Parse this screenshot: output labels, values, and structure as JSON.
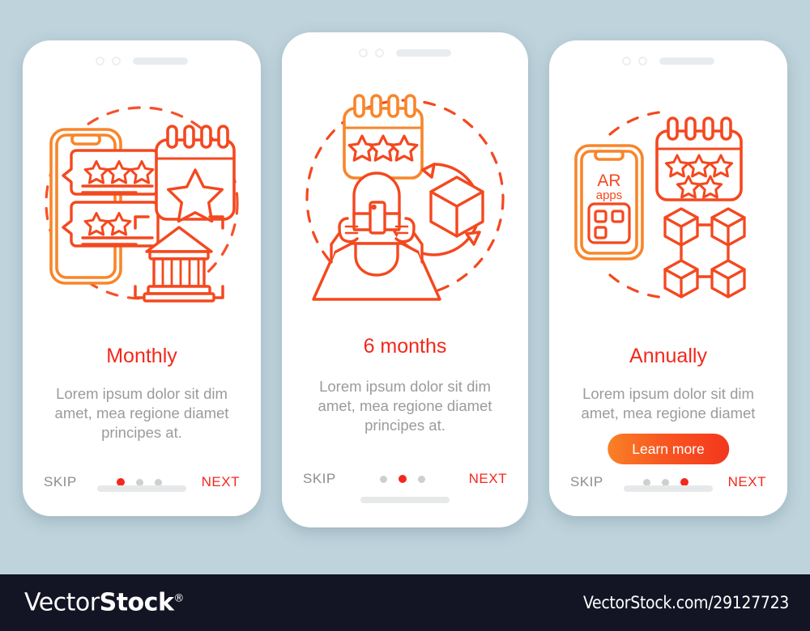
{
  "background_color": "#bed3dc",
  "accent_color": "#f3281c",
  "accent_orange": "#f98126",
  "muted_text_color": "#9b9b9b",
  "screens": [
    {
      "id": "monthly",
      "title": "Monthly",
      "description": "Lorem ipsum dolor sit dim amet, mea regione diamet principes at.",
      "skip_label": "SKIP",
      "next_label": "NEXT",
      "active_dot": 0,
      "dots": 3,
      "cta_label": null,
      "illustration": "phone-reviews-calendar-bank"
    },
    {
      "id": "six-months",
      "title": "6 months",
      "description": "Lorem ipsum dolor sit dim amet, mea regione diamet principes at.",
      "skip_label": "SKIP",
      "next_label": "NEXT",
      "active_dot": 1,
      "dots": 3,
      "cta_label": null,
      "illustration": "vr-person-calendar-cube"
    },
    {
      "id": "annually",
      "title": "Annually",
      "description": "Lorem ipsum dolor sit dim amet, mea regione diamet",
      "skip_label": "SKIP",
      "next_label": "NEXT",
      "active_dot": 2,
      "dots": 3,
      "cta_label": "Learn more",
      "illustration": "ar-apps-phone-calendar-blockchain",
      "phone_screen_text_primary": "AR",
      "phone_screen_text_secondary": "apps"
    }
  ],
  "footer": {
    "logo_part1": "Vector",
    "logo_part2": "Stock",
    "logo_registered": "®",
    "url": "VectorStock.com/29127723",
    "background_color": "#131424"
  }
}
